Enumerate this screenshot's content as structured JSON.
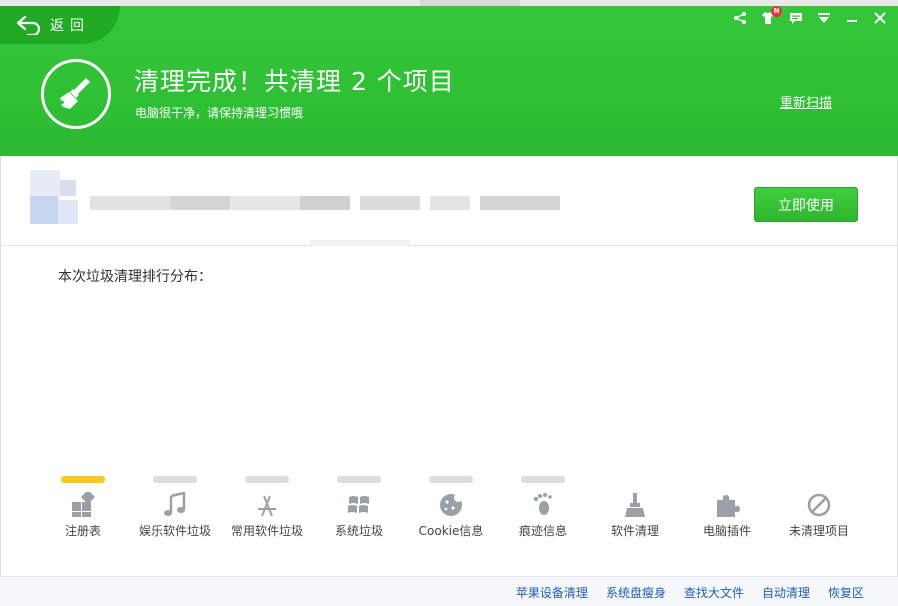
{
  "header": {
    "back_label": "返回",
    "title": "清理完成！共清理 2 个项目",
    "subtitle": "电脑很干净，请保持清理习惯哦",
    "rescan_label": "重新扫描",
    "badge": "N",
    "accent_color": "#2fc035"
  },
  "banner": {
    "use_button_label": "立即使用"
  },
  "section": {
    "label": "本次垃圾清理排行分布："
  },
  "categories": [
    {
      "label": "注册表",
      "icon": "registry-icon",
      "active": true
    },
    {
      "label": "娱乐软件垃圾",
      "icon": "music-note-icon",
      "active": false
    },
    {
      "label": "常用软件垃圾",
      "icon": "app-store-icon",
      "active": false
    },
    {
      "label": "系统垃圾",
      "icon": "windows-icon",
      "active": false
    },
    {
      "label": "Cookie信息",
      "icon": "cookie-icon",
      "active": false
    },
    {
      "label": "痕迹信息",
      "icon": "footprint-icon",
      "active": false
    },
    {
      "label": "软件清理",
      "icon": "broom-icon",
      "active": false
    },
    {
      "label": "电脑插件",
      "icon": "puzzle-icon",
      "active": false
    },
    {
      "label": "未清理项目",
      "icon": "prohibited-icon",
      "active": false
    }
  ],
  "footer": {
    "links": [
      "苹果设备清理",
      "系统盘瘦身",
      "查找大文件",
      "自动清理",
      "恢复区"
    ]
  }
}
